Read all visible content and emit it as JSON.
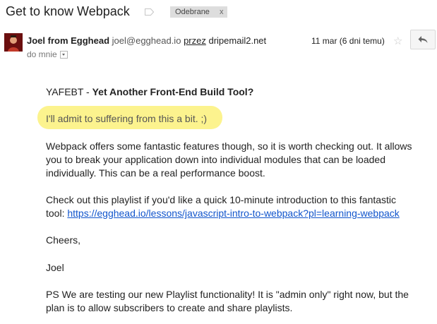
{
  "email": {
    "subject": "Get to know Webpack",
    "label_chip": "Odebrane",
    "label_chip_close": "x",
    "sender_name": "Joel from Egghead",
    "sender_email": "joel@egghead.io",
    "via_word": "przez",
    "via_domain": "dripemail2.net",
    "to": "do mnie",
    "date": "11 mar (6 dni temu)"
  },
  "content": {
    "title_prefix": "YAFEBT - ",
    "title_bold": "Yet Another Front-End Build Tool?",
    "admit": "I'll admit to suffering from this a bit. ;)",
    "p1_l1": "Webpack offers some fantastic features though, so it is worth checking out. It allows",
    "p1_l2": "you to break your application down into individual modules that can be loaded",
    "p1_l3": "individually. This can be a real performance boost.",
    "p2_l1": "Check out this playlist if you'd like a quick 10-minute introduction to this fantastic",
    "p2_l2_prefix": "tool: ",
    "link": "https://egghead.io/lessons/javascript-intro-to-webpack?pl=learning-webpack",
    "cheers": "Cheers,",
    "signature": "Joel",
    "ps_l1": "PS We are testing our new Playlist functionality! It is \"admin only\" right now, but the",
    "ps_l2": "plan is to allow subscribers to create and share playlists."
  },
  "icons": {
    "label": "label-icon",
    "star": "star-icon",
    "reply": "reply-icon",
    "dropdown": "chevron-down-icon",
    "avatar": "avatar"
  },
  "colors": {
    "highlight": "#fbf17a",
    "link": "#1155cc",
    "chip": "#dddddd"
  }
}
